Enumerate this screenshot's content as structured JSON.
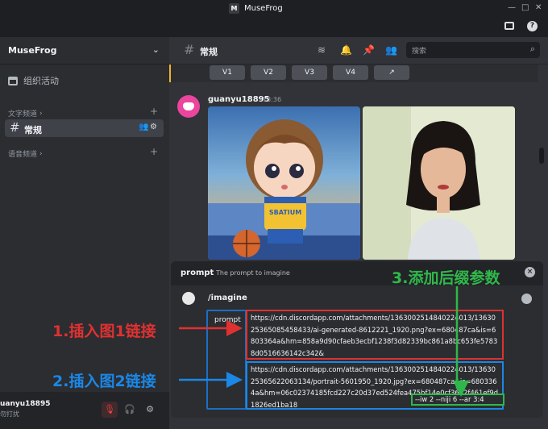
{
  "app": {
    "title": "MuseFrog",
    "logo_letter": "M"
  },
  "window_controls": {
    "minimize": "—",
    "maximize": "□",
    "close": "✕"
  },
  "titlebar_icons": [
    "inbox-icon",
    "help-icon"
  ],
  "sidebar": {
    "guild_name": "MuseFrog",
    "events_label": "组织活动",
    "text_category": "文字频道",
    "voice_category": "语音频道",
    "active_channel": "常规"
  },
  "user": {
    "name": "uanyu18895",
    "status": "勿打扰"
  },
  "channel_header": {
    "name": "常规",
    "search_placeholder": "搜索"
  },
  "variation_buttons": [
    "V1",
    "V2",
    "V3",
    "V4"
  ],
  "message": {
    "author": "guanyu18895",
    "time": "13:36"
  },
  "command": {
    "label": "prompt",
    "description": "The prompt to imagine",
    "name": "/imagine",
    "option": "prompt",
    "url1": "https://cdn.discordapp.com/attachments/1363002514840224013/1363025365085458433/ai-generated-8612221_1920.png?ex=680487ca&is=6803364a&hm=858a9d90cfaeb3ecbf1238f3d82339bc861a8bc653fe57838d0516636142c342&",
    "url2": "https://cdn.discordapp.com/attachments/1363002514840224013/1363025365622063134/portrait-5601950_1920.jpg?ex=680487ca&is=6803364a&hm=06c02374185fcd227c20d37ed524fea475bf14e0cf36d2f461ef9d1826ed1ba18",
    "suffix": "--iw 2 --niji 6 --ar 3:4"
  },
  "annotations": {
    "insert_image1": "1.插入图1链接",
    "insert_image2": "2.插入图2链接",
    "add_suffix": "3.添加后缀参数"
  },
  "colors": {
    "annotation_red": "#e03131",
    "annotation_blue": "#1b87e6",
    "annotation_green": "#2fb84a",
    "avatar_pink": "#eb459e"
  }
}
